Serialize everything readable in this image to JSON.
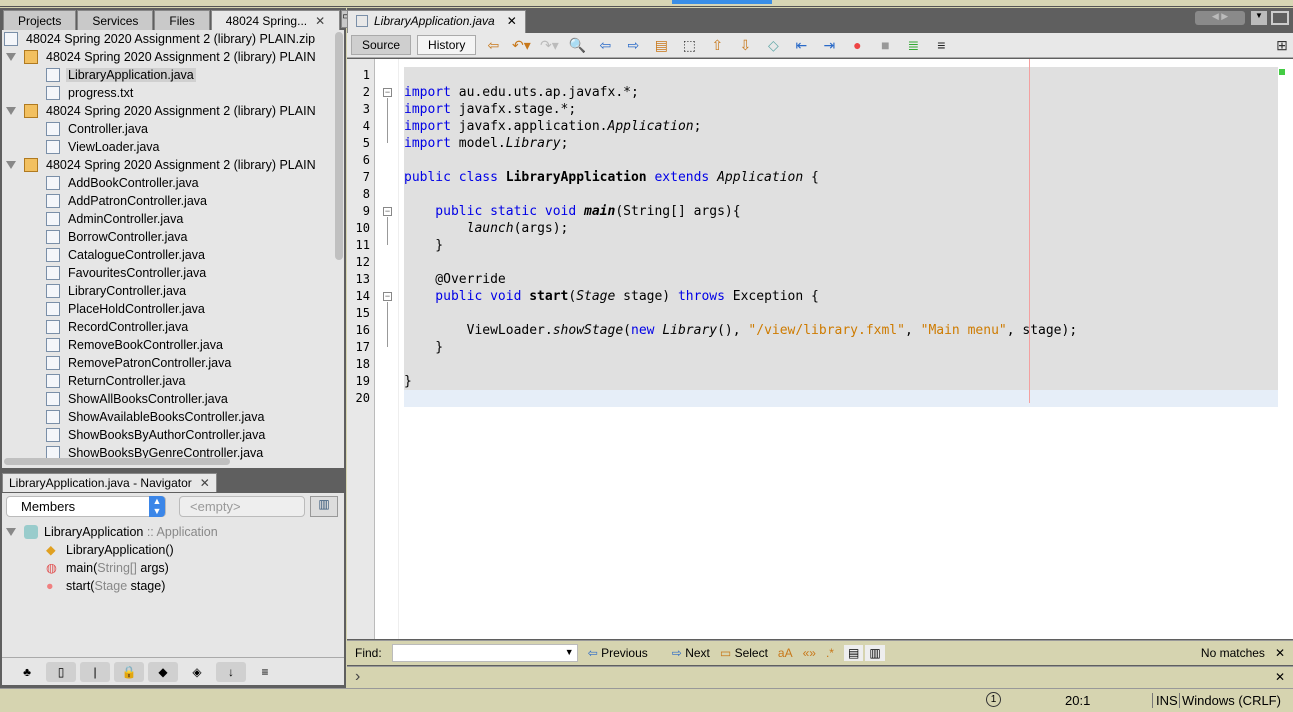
{
  "left_tabs": [
    "Projects",
    "Services",
    "Files",
    "48024 Spring..."
  ],
  "tree": [
    {
      "label": "48024 Spring 2020 Assignment 2 (library) PLAIN.zip",
      "indent": 0,
      "type": "jar"
    },
    {
      "label": "48024 Spring 2020 Assignment 2 (library) PLAIN",
      "indent": 1,
      "type": "pkg"
    },
    {
      "label": "LibraryApplication.java",
      "indent": 2,
      "type": "java",
      "selected": true
    },
    {
      "label": "progress.txt",
      "indent": 2,
      "type": "txt"
    },
    {
      "label": "48024 Spring 2020 Assignment 2 (library) PLAIN",
      "indent": 1,
      "type": "pkg"
    },
    {
      "label": "Controller.java",
      "indent": 2,
      "type": "java"
    },
    {
      "label": "ViewLoader.java",
      "indent": 2,
      "type": "java"
    },
    {
      "label": "48024 Spring 2020 Assignment 2 (library) PLAIN",
      "indent": 1,
      "type": "pkg"
    },
    {
      "label": "AddBookController.java",
      "indent": 2,
      "type": "java"
    },
    {
      "label": "AddPatronController.java",
      "indent": 2,
      "type": "java"
    },
    {
      "label": "AdminController.java",
      "indent": 2,
      "type": "java"
    },
    {
      "label": "BorrowController.java",
      "indent": 2,
      "type": "java"
    },
    {
      "label": "CatalogueController.java",
      "indent": 2,
      "type": "java"
    },
    {
      "label": "FavouritesController.java",
      "indent": 2,
      "type": "java"
    },
    {
      "label": "LibraryController.java",
      "indent": 2,
      "type": "java"
    },
    {
      "label": "PlaceHoldController.java",
      "indent": 2,
      "type": "java"
    },
    {
      "label": "RecordController.java",
      "indent": 2,
      "type": "java"
    },
    {
      "label": "RemoveBookController.java",
      "indent": 2,
      "type": "java"
    },
    {
      "label": "RemovePatronController.java",
      "indent": 2,
      "type": "java"
    },
    {
      "label": "ReturnController.java",
      "indent": 2,
      "type": "java"
    },
    {
      "label": "ShowAllBooksController.java",
      "indent": 2,
      "type": "java"
    },
    {
      "label": "ShowAvailableBooksController.java",
      "indent": 2,
      "type": "java"
    },
    {
      "label": "ShowBooksByAuthorController.java",
      "indent": 2,
      "type": "java"
    },
    {
      "label": "ShowBooksByGenreController.java",
      "indent": 2,
      "type": "java"
    }
  ],
  "navigator": {
    "title": "LibraryApplication.java - Navigator",
    "combo1": "Members",
    "combo2": "<empty>",
    "root": {
      "name": "LibraryApplication",
      "type": " :: Application"
    },
    "members": [
      {
        "name": "LibraryApplication()",
        "param": "",
        "tail": "",
        "icon": "constructor-icon"
      },
      {
        "name": "main(",
        "param": "String[]",
        "tail": " args)",
        "icon": "static-method-icon"
      },
      {
        "name": "start(",
        "param": "Stage",
        "tail": " stage)",
        "icon": "method-icon"
      }
    ]
  },
  "editor": {
    "tab": "LibraryApplication.java",
    "source": "Source",
    "history": "History",
    "lines": [
      [],
      [
        [
          "import",
          "kw"
        ],
        [
          " au.edu.uts.ap.javafx.*;",
          ""
        ]
      ],
      [
        [
          "import",
          "kw"
        ],
        [
          " javafx.stage.*;",
          ""
        ]
      ],
      [
        [
          "import",
          "kw"
        ],
        [
          " javafx.application.",
          ""
        ],
        [
          "Application",
          "i"
        ],
        [
          ";",
          ""
        ]
      ],
      [
        [
          "import",
          "kw"
        ],
        [
          " model.",
          ""
        ],
        [
          "Library",
          "i"
        ],
        [
          ";",
          ""
        ]
      ],
      [],
      [
        [
          "public class",
          "kw"
        ],
        [
          " ",
          ""
        ],
        [
          "LibraryApplication",
          "b"
        ],
        [
          " ",
          ""
        ],
        [
          "extends",
          "kw"
        ],
        [
          " ",
          ""
        ],
        [
          "Application",
          "i"
        ],
        [
          " {",
          ""
        ]
      ],
      [],
      [
        [
          "    public static void",
          "kw"
        ],
        [
          " ",
          ""
        ],
        [
          "main",
          "bi"
        ],
        [
          "(String[] args){",
          ""
        ]
      ],
      [
        [
          "        ",
          ""
        ],
        [
          "launch",
          "i"
        ],
        [
          "(args);",
          ""
        ]
      ],
      [
        [
          "    }",
          ""
        ]
      ],
      [],
      [
        [
          "    @Override",
          ""
        ]
      ],
      [
        [
          "    public void",
          "kw"
        ],
        [
          " ",
          ""
        ],
        [
          "start",
          "b"
        ],
        [
          "(",
          ""
        ],
        [
          "Stage",
          "i"
        ],
        [
          " stage) ",
          ""
        ],
        [
          "throws",
          "kw"
        ],
        [
          " Exception {",
          ""
        ]
      ],
      [],
      [
        [
          "        ViewLoader.",
          ""
        ],
        [
          "showStage",
          "i"
        ],
        [
          "(",
          ""
        ],
        [
          "new",
          "kw"
        ],
        [
          " ",
          ""
        ],
        [
          "Library",
          "i"
        ],
        [
          "(), ",
          ""
        ],
        [
          "\"/view/library.fxml\"",
          "s"
        ],
        [
          ", ",
          ""
        ],
        [
          "\"Main menu\"",
          "s"
        ],
        [
          ", stage);",
          ""
        ]
      ],
      [
        [
          "    }",
          ""
        ]
      ],
      [],
      [
        [
          "}",
          ""
        ]
      ],
      []
    ],
    "folds": [
      2,
      9,
      14
    ]
  },
  "find": {
    "label": "Find:",
    "previous": "Previous",
    "next": "Next",
    "select": "Select",
    "status": "No matches"
  },
  "status": {
    "position": "20:1",
    "mode": "INS",
    "line_ending": "Windows (CRLF)",
    "notifications": "1"
  }
}
